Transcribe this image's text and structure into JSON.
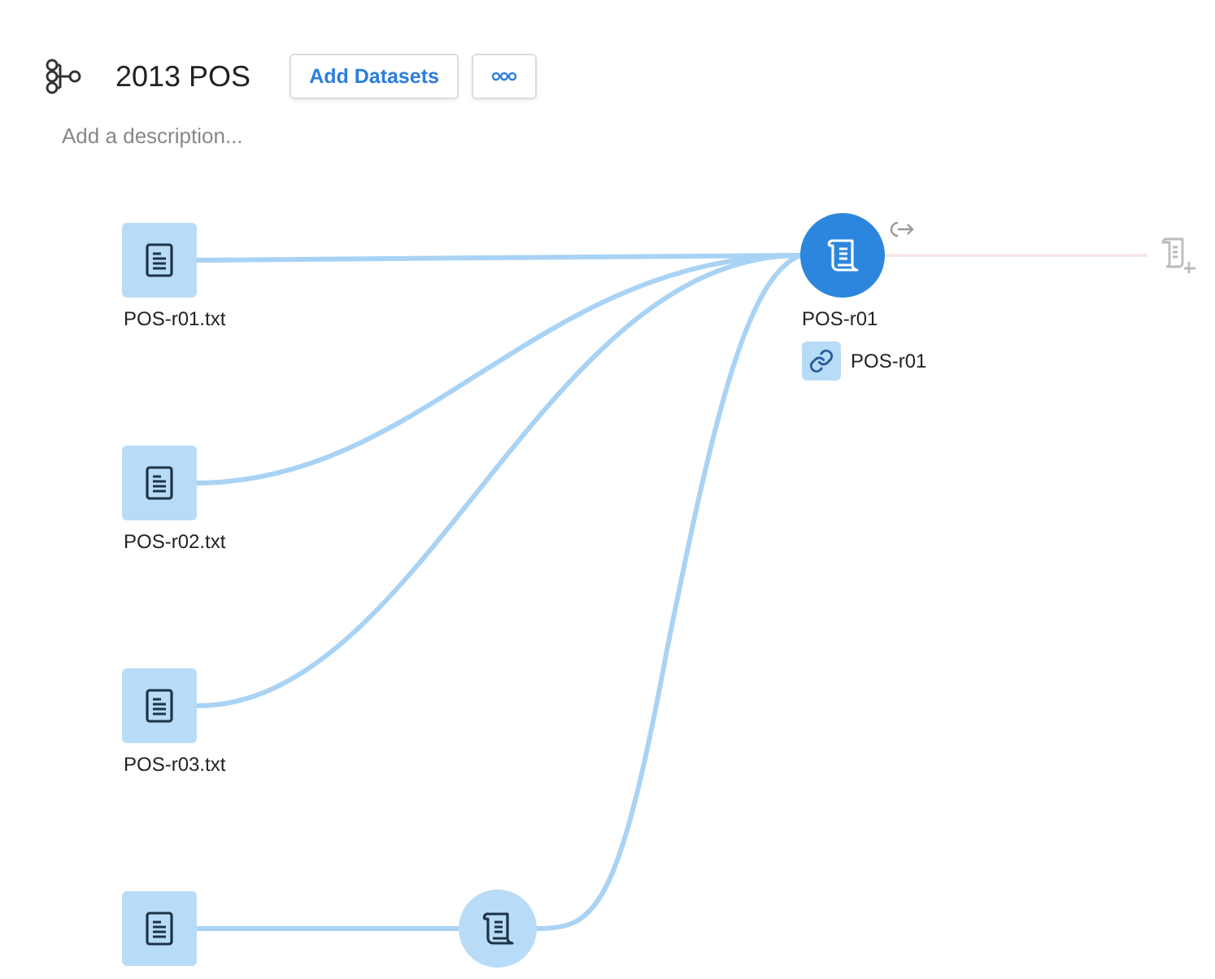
{
  "flow": {
    "title": "2013 POS",
    "description": {
      "placeholder": "Add a description..."
    }
  },
  "toolbar": {
    "buttons": [
      {
        "kind": "text",
        "label": "Add Datasets"
      },
      {
        "kind": "more"
      }
    ]
  },
  "nodes": [
    {
      "kind": "dataset",
      "label": "POS-r01.txt"
    },
    {
      "kind": "dataset",
      "label": "POS-r02.txt"
    },
    {
      "kind": "dataset",
      "label": "POS-r03.txt"
    },
    {
      "kind": "dataset"
    },
    {
      "kind": "recipe",
      "selected": false
    },
    {
      "kind": "recipe",
      "selected": true,
      "label": "POS-r01",
      "link": "POS-r01"
    },
    {
      "kind": "output"
    }
  ]
}
